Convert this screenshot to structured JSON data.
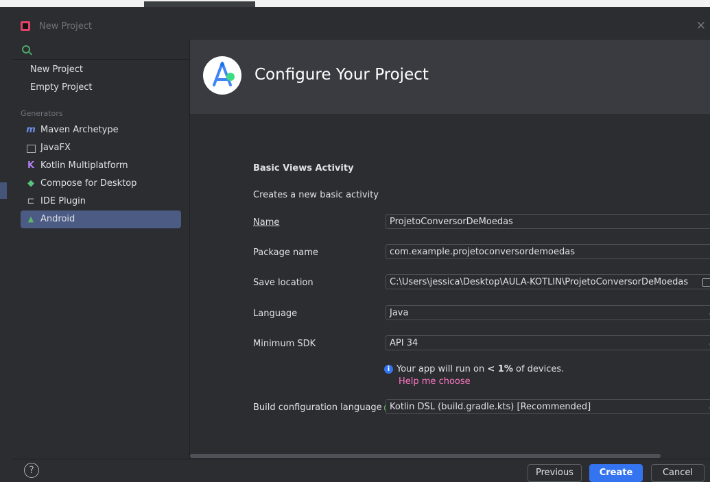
{
  "window": {
    "title": "New Project"
  },
  "sidebar": {
    "items": [
      {
        "label": "New Project"
      },
      {
        "label": "Empty Project"
      }
    ],
    "generators_label": "Generators",
    "generators": [
      {
        "label": "Maven Archetype",
        "icon": "maven-icon"
      },
      {
        "label": "JavaFX",
        "icon": "javafx-icon"
      },
      {
        "label": "Kotlin Multiplatform",
        "icon": "kotlin-icon"
      },
      {
        "label": "Compose for Desktop",
        "icon": "compose-icon"
      },
      {
        "label": "IDE Plugin",
        "icon": "plugin-icon"
      },
      {
        "label": "Android",
        "icon": "android-icon",
        "selected": true
      }
    ]
  },
  "header": {
    "title": "Configure Your Project"
  },
  "form": {
    "activity_title": "Basic Views Activity",
    "activity_desc": "Creates a new basic activity",
    "name_label": "Name",
    "name_value": "ProjetoConversorDeMoedas",
    "package_label": "Package name",
    "package_value": "com.example.projetoconversordemoedas",
    "save_label": "Save location",
    "save_value": "C:\\Users\\jessica\\Desktop\\AULA-KOTLIN\\ProjetoConversorDeMoedas",
    "language_label": "Language",
    "language_value": "Java",
    "sdk_label": "Minimum SDK",
    "sdk_value": "API 34",
    "info_prefix": "Your app will run on ",
    "info_percent": "< 1%",
    "info_suffix": " of devices.",
    "help_link": "Help me choose",
    "build_label": "Build configuration language",
    "build_value": "Kotlin DSL (build.gradle.kts) [Recommended]"
  },
  "footer": {
    "help": "?",
    "previous": "Previous",
    "create": "Create",
    "cancel": "Cancel"
  },
  "colors": {
    "accent": "#3574f0",
    "selected": "#4b5b84",
    "link": "#ff78c6"
  }
}
